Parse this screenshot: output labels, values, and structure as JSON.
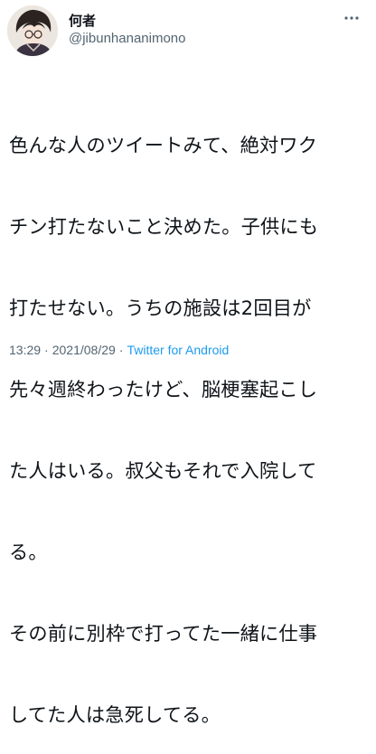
{
  "tweet": {
    "author": {
      "display_name": "何者",
      "handle": "@jibunhananimono",
      "avatar_icon": "user-avatar-illustration"
    },
    "more_icon": "more-horizontal-icon",
    "lines": [
      "色んな人のツイートみて、絶対ワク",
      "チン打たないこと決めた。子供にも",
      "打たせない。うちの施設は2回目が",
      "先々週終わったけど、脳梗塞起こし",
      "た人はいる。叔父もそれで入院して",
      "る。",
      "その前に別枠で打ってた一緒に仕事",
      "してた人は急死してる。"
    ],
    "meta": {
      "time": "13:29",
      "separator": "·",
      "date": "2021/08/29",
      "source": "Twitter for Android"
    }
  },
  "colors": {
    "text": "#0f1419",
    "secondary": "#536471",
    "link": "#1d9bf0"
  }
}
